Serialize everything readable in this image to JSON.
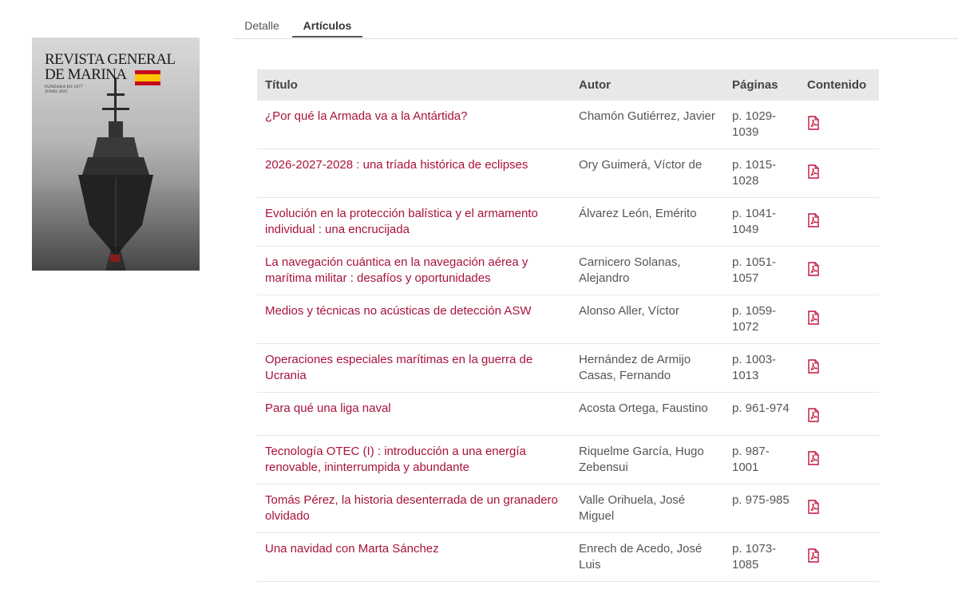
{
  "cover": {
    "title": "REVISTA GENERAL DE MARINA",
    "subtitle_line1": "FUNDADA EN 1877",
    "subtitle_line2": "JUNIO 2025"
  },
  "tabs": [
    {
      "label": "Detalle"
    },
    {
      "label": "Artículos"
    }
  ],
  "table": {
    "headers": {
      "title": "Título",
      "author": "Autor",
      "pages": "Páginas",
      "content": "Contenido"
    },
    "rows": [
      {
        "title": "¿Por qué la Armada va a la Antártida?",
        "author": "Chamón Gutiérrez, Javier",
        "pages": "p. 1029-1039"
      },
      {
        "title": "2026-2027-2028 : una tríada histórica de eclipses",
        "author": "Ory Guimerá, Víctor de",
        "pages": "p. 1015-1028"
      },
      {
        "title": "Evolución en la protección balística y el armamento individual : una encrucijada",
        "author": "Álvarez León, Emérito",
        "pages": "p. 1041-1049"
      },
      {
        "title": "La navegación cuántica en la navegación aérea y marítima militar : desafíos y oportunidades",
        "author": "Carnicero Solanas, Alejandro",
        "pages": "p. 1051-1057"
      },
      {
        "title": "Medios y técnicas no acústicas de detección ASW",
        "author": "Alonso Aller, Víctor",
        "pages": "p. 1059-1072"
      },
      {
        "title": "Operaciones especiales marítimas en la guerra de Ucrania",
        "author": "Hernández de Armijo Casas, Fernando",
        "pages": "p. 1003-1013"
      },
      {
        "title": "Para qué una liga naval",
        "author": "Acosta Ortega, Faustino",
        "pages": "p. 961-974"
      },
      {
        "title": "Tecnología OTEC (I) : introducción a una energía renovable, ininterrumpida y abundante",
        "author": "Riquelme García, Hugo Zebensui",
        "pages": "p. 987-1001"
      },
      {
        "title": "Tomás Pérez, la historia desenterrada de un granadero olvidado",
        "author": "Valle Orihuela, José Miguel",
        "pages": "p. 975-985"
      },
      {
        "title": "Una navidad con Marta Sánchez",
        "author": "Enrech de Acedo, José Luis",
        "pages": "p. 1073-1085"
      }
    ]
  },
  "colors": {
    "link": "#a8133a",
    "header_bg": "#e8e8e8",
    "pdf_icon": "#c0143c"
  },
  "icons": {
    "content": "pdf-icon"
  }
}
